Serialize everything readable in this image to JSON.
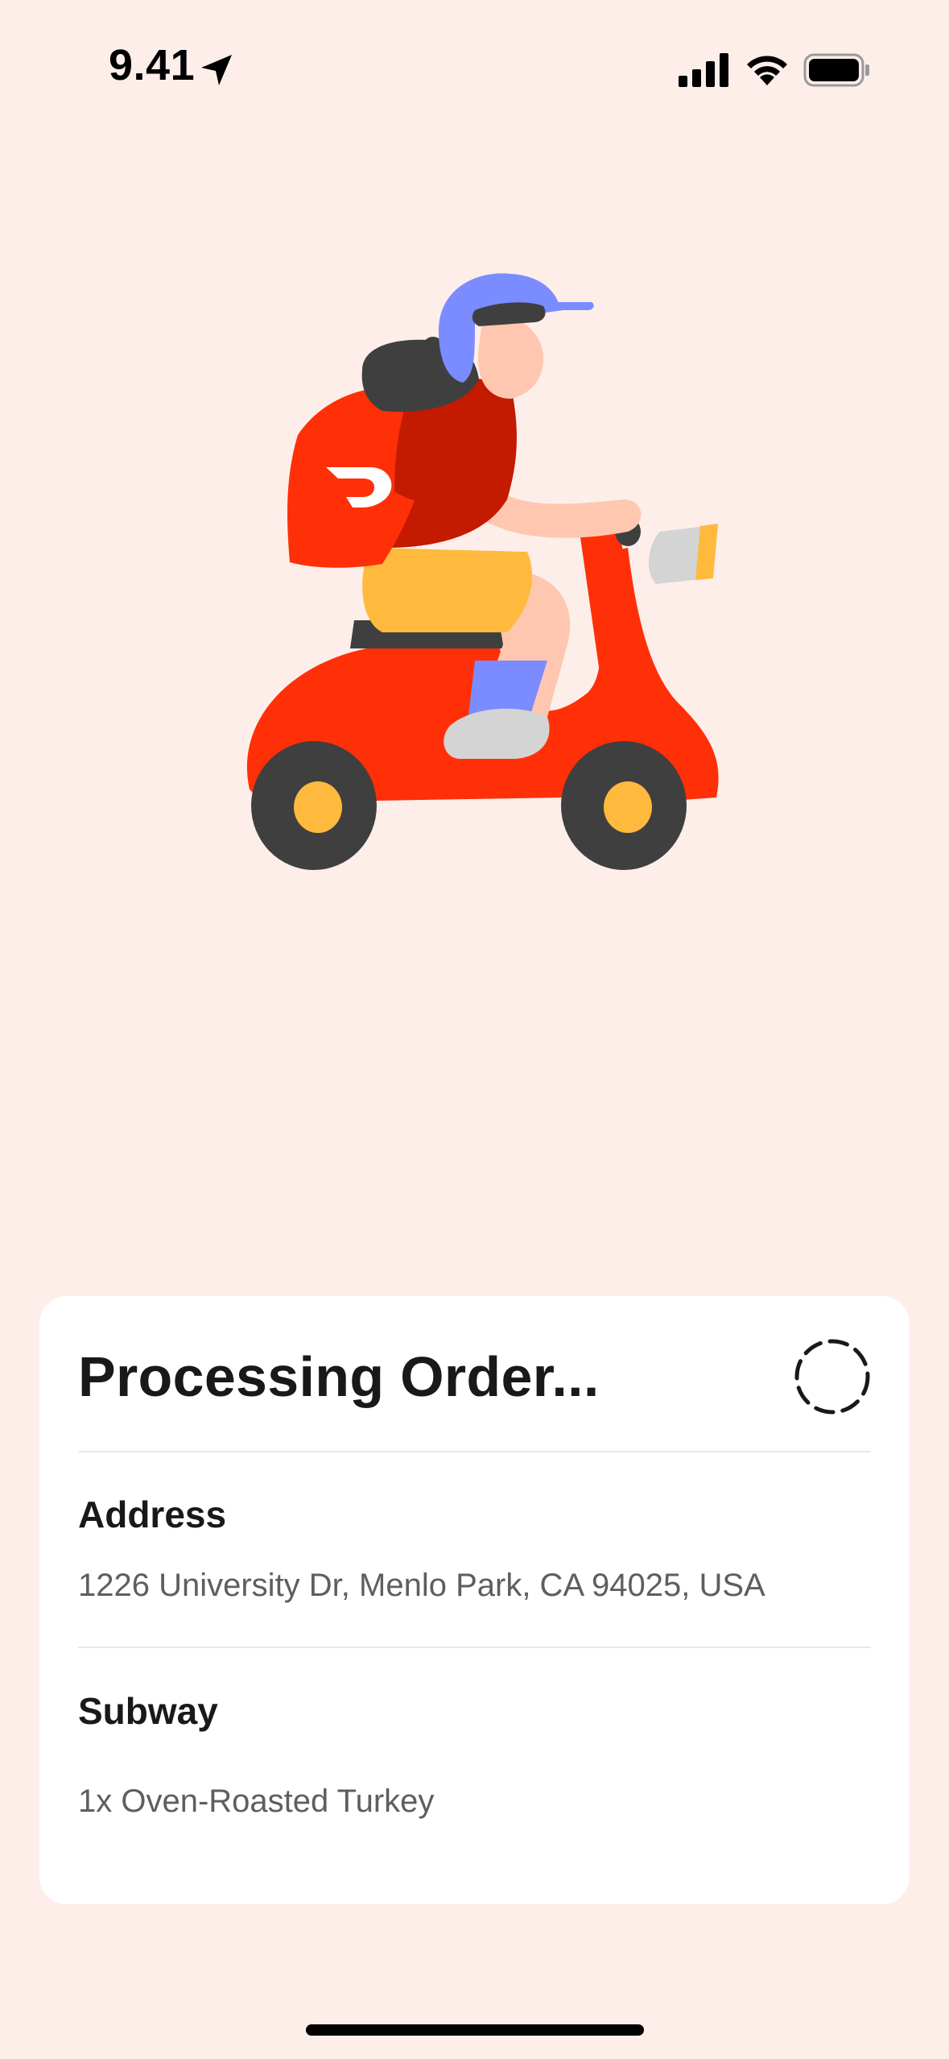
{
  "status_bar": {
    "time": "9.41",
    "icons": [
      "location-arrow-icon",
      "signal-icon",
      "wifi-icon",
      "battery-icon"
    ]
  },
  "illustration": {
    "name": "courier-on-scooter-illustration",
    "colors": {
      "scooter": "#FF3008",
      "helmet": "#7A8CFF",
      "jacket": "#C41A00",
      "backpack": "#FF3008",
      "shorts": "#FFBA3E",
      "wheels": "#3F3F3F",
      "hubs": "#FFBA3E",
      "skin": "#FFC7B0"
    }
  },
  "order_card": {
    "title": "Processing Order...",
    "spinner_icon": "loading-spinner-icon",
    "address_label": "Address",
    "address_value": "1226 University Dr, Menlo Park, CA 94025, USA",
    "store_label": "Subway",
    "items": [
      "1x Oven-Roasted Turkey"
    ]
  },
  "colors": {
    "background": "#FDEEEA",
    "card": "#FFFFFF",
    "primary_text": "#191919",
    "secondary_text": "#5E5E5E",
    "brand_red": "#FF3008"
  }
}
